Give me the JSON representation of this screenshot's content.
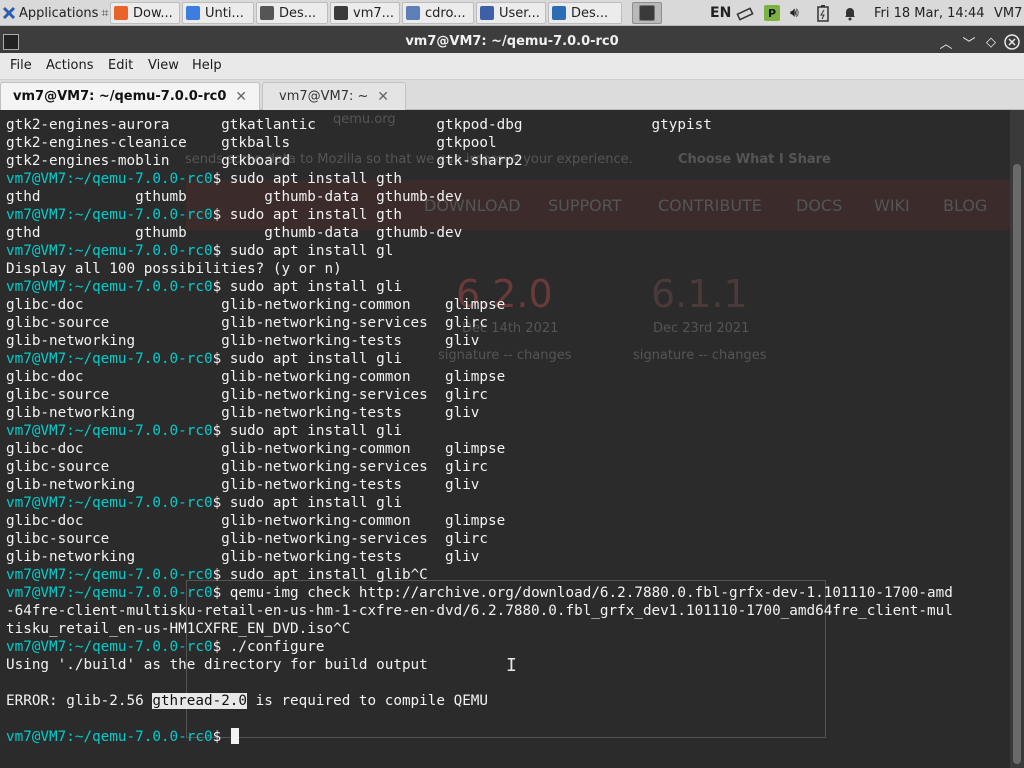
{
  "panel": {
    "applications": "Applications",
    "tasks": [
      {
        "label": "Dow...",
        "icon": "firefox-icon",
        "color": "#e8632a"
      },
      {
        "label": "Unti...",
        "icon": "chrome-icon",
        "color": "#3b7de0"
      },
      {
        "label": "Des...",
        "icon": "window-icon",
        "color": "#555555"
      },
      {
        "label": "vm7...",
        "icon": "terminal-icon",
        "color": "#3b3b3b"
      },
      {
        "label": "cdro...",
        "icon": "folder-icon",
        "color": "#5c7fb8"
      },
      {
        "label": "User...",
        "icon": "user-icon",
        "color": "#3d5fa8"
      },
      {
        "label": "Des...",
        "icon": "desktop-icon",
        "color": "#2b6cb5"
      }
    ],
    "active_task_icon": "terminal-icon",
    "lang": "EN",
    "clock": "Fri 18 Mar, 14:44",
    "user": "VM7"
  },
  "window": {
    "title": "vm7@VM7: ~/qemu-7.0.0-rc0"
  },
  "menu": [
    "File",
    "Actions",
    "Edit",
    "View",
    "Help"
  ],
  "tabs": [
    {
      "label": "vm7@VM7: ~/qemu-7.0.0-rc0",
      "active": true
    },
    {
      "label": "vm7@VM7: ~",
      "active": false
    }
  ],
  "ghost": {
    "url": "qemu.org",
    "notice": "sends some data to Mozilla so that we can improve your experience.",
    "choose": "Choose What I Share",
    "nav": [
      "DOWNLOAD",
      "SUPPORT",
      "CONTRIBUTE",
      "DOCS",
      "WIKI",
      "BLOG"
    ],
    "version_a": "6.2.0",
    "version_b": "6.1.1",
    "date_a": "Dec 14th 2021",
    "date_b": "Dec 23rd 2021",
    "sig_a": "signature -- changes",
    "sig_b": "signature -- changes"
  },
  "terminal": {
    "prompt_user": "vm7@VM7",
    "lines": [
      {
        "text": "gtk2-engines-aurora      gtkatlantic              gtkpod-dbg               gtypist"
      },
      {
        "text": "gtk2-engines-cleanice    gtkballs                 gtkpool"
      },
      {
        "text": "gtk2-engines-moblin      gtkboard                 gtk-sharp2"
      },
      {
        "prompt": "vm7@VM7:~/qemu-7.0.0-rc0",
        "text": "$ sudo apt install gth"
      },
      {
        "text": "gthd           gthumb         gthumb-data  gthumb-dev"
      },
      {
        "prompt": "vm7@VM7:~/qemu-7.0.0-rc0",
        "text": "$ sudo apt install gth"
      },
      {
        "text": "gthd           gthumb         gthumb-data  gthumb-dev"
      },
      {
        "prompt": "vm7@VM7:~/qemu-7.0.0-rc0",
        "text": "$ sudo apt install gl"
      },
      {
        "text": "Display all 100 possibilities? (y or n)"
      },
      {
        "prompt": "vm7@VM7:~/qemu-7.0.0-rc0",
        "text": "$ sudo apt install gli"
      },
      {
        "text": "glibc-doc                glib-networking-common    glimpse"
      },
      {
        "text": "glibc-source             glib-networking-services  glirc"
      },
      {
        "text": "glib-networking          glib-networking-tests     gliv"
      },
      {
        "prompt": "vm7@VM7:~/qemu-7.0.0-rc0",
        "text": "$ sudo apt install gli"
      },
      {
        "text": "glibc-doc                glib-networking-common    glimpse"
      },
      {
        "text": "glibc-source             glib-networking-services  glirc"
      },
      {
        "text": "glib-networking          glib-networking-tests     gliv"
      },
      {
        "prompt": "vm7@VM7:~/qemu-7.0.0-rc0",
        "text": "$ sudo apt install gli"
      },
      {
        "text": "glibc-doc                glib-networking-common    glimpse"
      },
      {
        "text": "glibc-source             glib-networking-services  glirc"
      },
      {
        "text": "glib-networking          glib-networking-tests     gliv"
      },
      {
        "prompt": "vm7@VM7:~/qemu-7.0.0-rc0",
        "text": "$ sudo apt install gli"
      },
      {
        "text": "glibc-doc                glib-networking-common    glimpse"
      },
      {
        "text": "glibc-source             glib-networking-services  glirc"
      },
      {
        "text": "glib-networking          glib-networking-tests     gliv"
      },
      {
        "prompt": "vm7@VM7:~/qemu-7.0.0-rc0",
        "text": "$ sudo apt install glib^C"
      },
      {
        "prompt": "vm7@VM7:~/qemu-7.0.0-rc0",
        "text": "$ qemu-img check http://archive.org/download/6.2.7880.0.fbl-grfx-dev-1.101110-1700-amd"
      },
      {
        "text": "-64fre-client-multisku-retail-en-us-hm-1-cxfre-en-dvd/6.2.7880.0.fbl_grfx_dev1.101110-1700_amd64fre_client-mul"
      },
      {
        "text": "tisku_retail_en-us-HM1CXFRE_EN_DVD.iso^C"
      },
      {
        "prompt": "vm7@VM7:~/qemu-7.0.0-rc0",
        "text": "$ ./configure"
      },
      {
        "text": "Using './build' as the directory for build output"
      },
      {
        "text": ""
      },
      {
        "text": "ERROR: glib-2.56 ",
        "highlight": "gthread-2.0",
        "after": " is required to compile QEMU"
      },
      {
        "text": ""
      },
      {
        "prompt": "vm7@VM7:~/qemu-7.0.0-rc0",
        "text": "$ ",
        "cursor": true
      }
    ]
  },
  "colors": {
    "prompt": "#00cdcd",
    "terminal_bg": "#2b2b2b",
    "terminal_fg": "#f2f2f2"
  }
}
